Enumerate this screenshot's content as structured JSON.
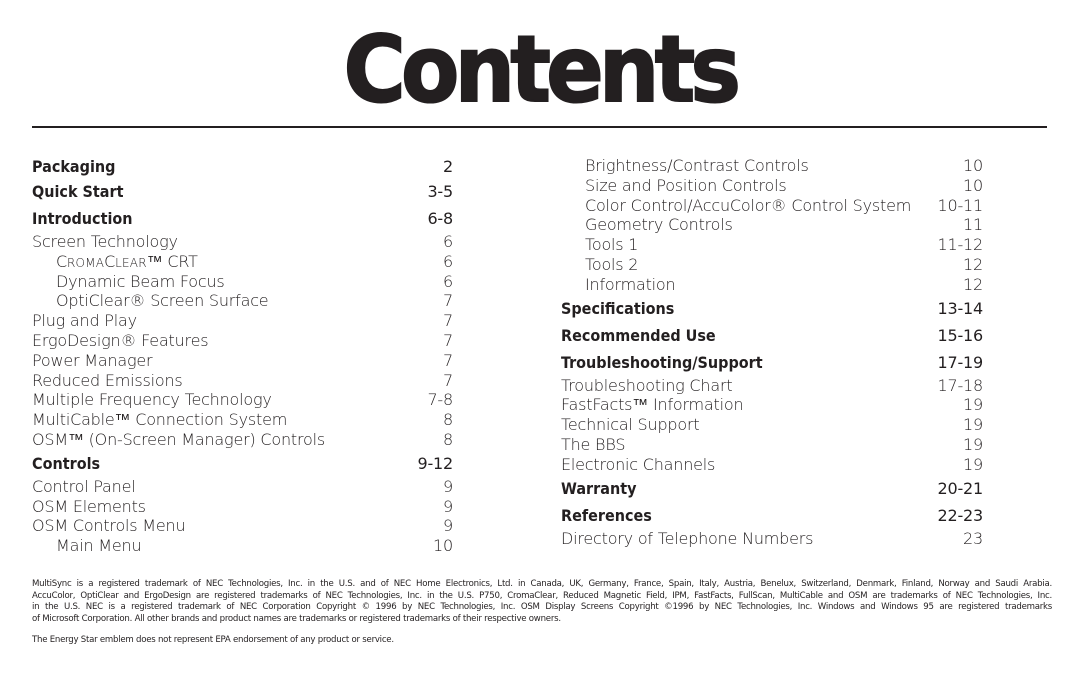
{
  "title": "Contents",
  "left_column": [
    {
      "label": "Packaging",
      "page": "2",
      "type": "head"
    },
    {
      "label": "Quick Start",
      "page": "3-5",
      "type": "head"
    },
    {
      "label": "Introduction",
      "page": "6-8",
      "type": "head"
    },
    {
      "label": "Screen Technology",
      "page": "6",
      "type": "item"
    },
    {
      "label": "CromaClear™ CRT",
      "page": "6",
      "type": "sub"
    },
    {
      "label": "Dynamic Beam Focus",
      "page": "6",
      "type": "sub"
    },
    {
      "label": "OptiClear® Screen Surface",
      "page": "7",
      "type": "sub"
    },
    {
      "label": "Plug and Play",
      "page": "7",
      "type": "item"
    },
    {
      "label": "ErgoDesign® Features",
      "page": "7",
      "type": "item"
    },
    {
      "label": "Power Manager",
      "page": "7",
      "type": "item"
    },
    {
      "label": "Reduced Emissions",
      "page": "7",
      "type": "item"
    },
    {
      "label": "Multiple Frequency Technology",
      "page": "7-8",
      "type": "item"
    },
    {
      "label": "MultiCable™ Connection System",
      "page": "8",
      "type": "item"
    },
    {
      "label": "OSM™ (On-Screen Manager) Controls",
      "page": "8",
      "type": "item"
    },
    {
      "label": "Controls",
      "page": "9-12",
      "type": "head"
    },
    {
      "label": "Control Panel",
      "page": "9",
      "type": "item"
    },
    {
      "label": "OSM Elements",
      "page": "9",
      "type": "item"
    },
    {
      "label": "OSM Controls Menu",
      "page": "9",
      "type": "item"
    },
    {
      "label": "Main Menu",
      "page": "10",
      "type": "sub"
    }
  ],
  "right_column": [
    {
      "label": "Brightness/Contrast Controls",
      "page": "10",
      "type": "sub"
    },
    {
      "label": "Size and Position Controls",
      "page": "10",
      "type": "sub"
    },
    {
      "label": "Color Control/AccuColor® Control System",
      "page": "10-11",
      "type": "sub"
    },
    {
      "label": "Geometry Controls",
      "page": "11",
      "type": "sub"
    },
    {
      "label": "Tools 1",
      "page": "11-12",
      "type": "sub"
    },
    {
      "label": "Tools 2",
      "page": "12",
      "type": "sub"
    },
    {
      "label": "Information",
      "page": "12",
      "type": "sub"
    },
    {
      "label": "Specifications",
      "page": "13-14",
      "type": "head"
    },
    {
      "label": "Recommended Use",
      "page": "15-16",
      "type": "head"
    },
    {
      "label": "Troubleshooting/Support",
      "page": "17-19",
      "type": "head"
    },
    {
      "label": "Troubleshooting Chart",
      "page": "17-18",
      "type": "item"
    },
    {
      "label": "FastFacts™ Information",
      "page": "19",
      "type": "item"
    },
    {
      "label": "Technical Support",
      "page": "19",
      "type": "item"
    },
    {
      "label": "The BBS",
      "page": "19",
      "type": "item"
    },
    {
      "label": "Electronic Channels",
      "page": "19",
      "type": "item"
    },
    {
      "label": "Warranty",
      "page": "20-21",
      "type": "head"
    },
    {
      "label": "References",
      "page": "22-23",
      "type": "head"
    },
    {
      "label": "Directory of Telephone Numbers",
      "page": "23",
      "type": "item"
    }
  ],
  "footer": {
    "trademark_lines": [
      "MultiSync is a registered trademark of NEC Technologies, Inc. in the U.S. and of NEC Home Electronics, Ltd. in Canada, UK, Germany, France, Spain, Italy, Austria, Benelux, Switzerland, Denmark, Finland, Norway and Saudi Arabia.",
      "AccuColor, OptiClear and ErgoDesign are registered trademarks of NEC Technologies, Inc. in the U.S. P750, CromaClear, Reduced Magnetic Field, IPM, FastFacts, FullScan, MultiCable and OSM are trademarks of NEC Technologies, Inc.",
      "in the U.S. NEC is a registered trademark of NEC Corporation Copyright © 1996 by NEC Technologies, Inc. OSM Display Screens Copyright ©1996 by NEC Technologies, Inc. Windows and Windows 95 are registered trademarks",
      "of Microsoft Corporation. All other brands and product names are trademarks or registered trademarks of their respective owners."
    ],
    "energy_star": "The Energy Star emblem does not represent EPA endorsement of any product or service."
  }
}
